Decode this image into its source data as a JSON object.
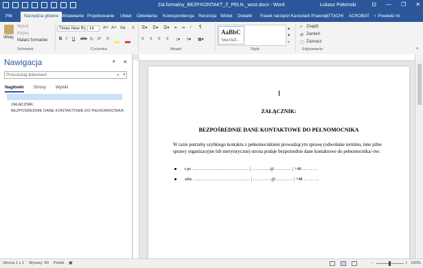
{
  "window": {
    "title": "Zal.formalny_BEZP.KONTAKT_Z_PELN._wzor.docx - Word",
    "user": "Łukasz Połomski",
    "minimize": "—",
    "restore": "❐",
    "close": "✕",
    "ribbon_display": "⊡"
  },
  "tabs": [
    "Plik",
    "Narzędzia główne",
    "Wstawianie",
    "Projektowanie",
    "Układ",
    "Odwołania",
    "Korespondencja",
    "Recenzja",
    "Widok",
    "Dodatki",
    "Pasek narzędzi Kancelarii Prawnej",
    "ATTACHI",
    "ACROBAT",
    "♀ Powiedz mi"
  ],
  "ribbon": {
    "paste_label": "Wklej",
    "cut_label": "Wytnij",
    "copy_label": "Kopiuj",
    "format_painter_label": "Malarz formatów",
    "clipboard_group": "Schowek",
    "font_name": "Times New Ro",
    "font_size": "14",
    "font_group": "Czcionka",
    "paragraph_group": "Akapit",
    "style_sample": "AaBbC",
    "style_name": "Tytuł DUŻ...",
    "styles_group": "Style",
    "find_label": "Znajdź",
    "replace_label": "Zamień",
    "select_label": "Zaznacz",
    "editing_group": "Edytowanie",
    "bold": "B",
    "italic": "I",
    "underline": "U",
    "strike": "abc",
    "subscript": "x₂",
    "superscript": "x²"
  },
  "navigation": {
    "title": "Nawigacja",
    "search_placeholder": "Przeszukaj dokument",
    "tabs": [
      "Nagłówki",
      "Strony",
      "Wyniki"
    ],
    "items": [
      "ZAŁĄCZNIK:",
      "BEZPOŚREDNIE DANE KONTAKTOWE DO PEŁNOMOCNIKA"
    ]
  },
  "document": {
    "heading1": "ZAŁĄCZNIK:",
    "heading2": "BEZPOŚREDNIE DANE KONTAKTOWE DO PEŁNOMOCNIKA",
    "body": "W razie potrzeby szybkiego kontaktu z pełnomocnikiem prowadzącym sprawę (odwołanie terminu, inne pilne sprawy organizacyjne lub merytoryczne) strona podaje bezpośrednie dane kontaktowe do pełnomocnika/-ów:",
    "bullets": [
      "r.pr. ………………………………… | ………….@………… | +48 … … …",
      "adw. ………………………………… | ………….@………… | +48 … … …"
    ]
  },
  "statusbar": {
    "page": "Strona 1 z 1",
    "words": "Wyrazy: 50",
    "language": "Polski",
    "zoom": "100%"
  }
}
